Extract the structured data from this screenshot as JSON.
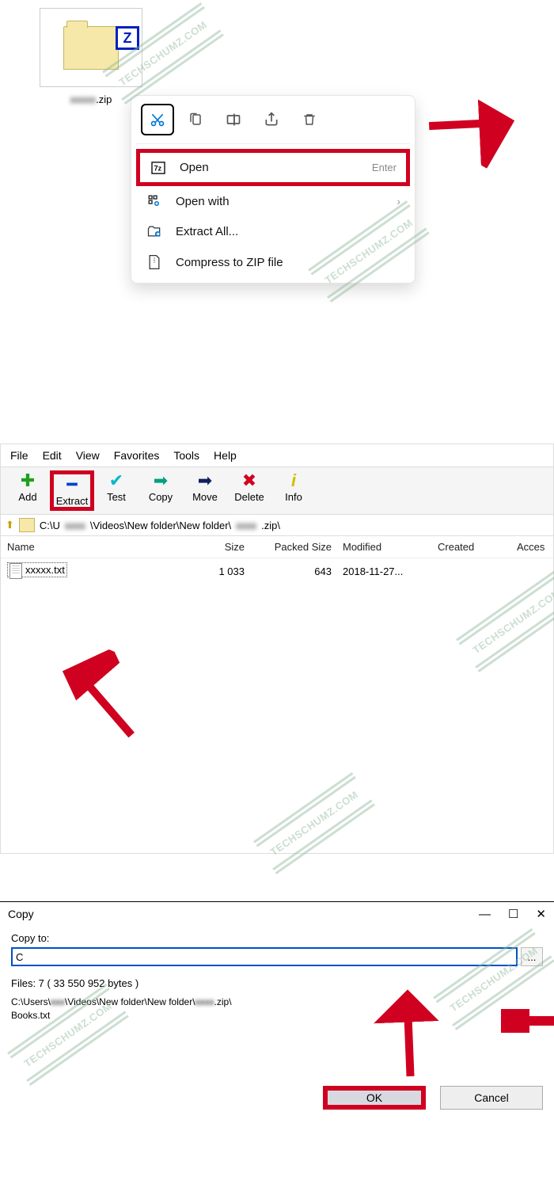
{
  "watermark": "TECHSCHUMZ.COM",
  "section1": {
    "file_label_ext": ".zip",
    "ctx_toolbar": [
      "cut",
      "copy",
      "rename",
      "share",
      "delete"
    ],
    "items": [
      {
        "icon": "7z-icon",
        "label": "Open",
        "shortcut": "Enter"
      },
      {
        "icon": "openwith-icon",
        "label": "Open with",
        "chevron": true
      },
      {
        "icon": "extract-icon",
        "label": "Extract All..."
      },
      {
        "icon": "compress-icon",
        "label": "Compress to ZIP file"
      }
    ]
  },
  "section2": {
    "menubar": [
      "File",
      "Edit",
      "View",
      "Favorites",
      "Tools",
      "Help"
    ],
    "toolbar": [
      {
        "name": "Add",
        "color": "#1fa01f",
        "glyph": "✚"
      },
      {
        "name": "Extract",
        "color": "#0040d0",
        "glyph": "━"
      },
      {
        "name": "Test",
        "color": "#00b8c8",
        "glyph": "✔"
      },
      {
        "name": "Copy",
        "color": "#00a080",
        "glyph": "➡"
      },
      {
        "name": "Move",
        "color": "#102060",
        "glyph": "➡"
      },
      {
        "name": "Delete",
        "color": "#d00020",
        "glyph": "✖"
      },
      {
        "name": "Info",
        "color": "#d0c000",
        "glyph": "ℹ"
      }
    ],
    "addr_prefix": "C:\\U",
    "addr_mid": "\\Videos\\New folder\\New folder\\",
    "addr_suffix": ".zip\\",
    "headers": {
      "name": "Name",
      "size": "Size",
      "psize": "Packed Size",
      "mod": "Modified",
      "cre": "Created",
      "acc": "Acces"
    },
    "row": {
      "name_ext": ".txt",
      "size": "1 033",
      "psize": "643",
      "mod": "2018-11-27..."
    }
  },
  "section3": {
    "title": "Copy",
    "copy_to": "Copy to:",
    "path_value": "C",
    "browse": "...",
    "files_info": "Files: 7 ( 33 550 952 bytes )",
    "path1_a": "C:\\Users\\",
    "path1_b": "\\Videos\\New folder\\New folder\\",
    "path1_c": ".zip\\",
    "path2": "Books.txt",
    "ok": "OK",
    "cancel": "Cancel",
    "min": "—",
    "max": "☐",
    "close": "✕"
  }
}
